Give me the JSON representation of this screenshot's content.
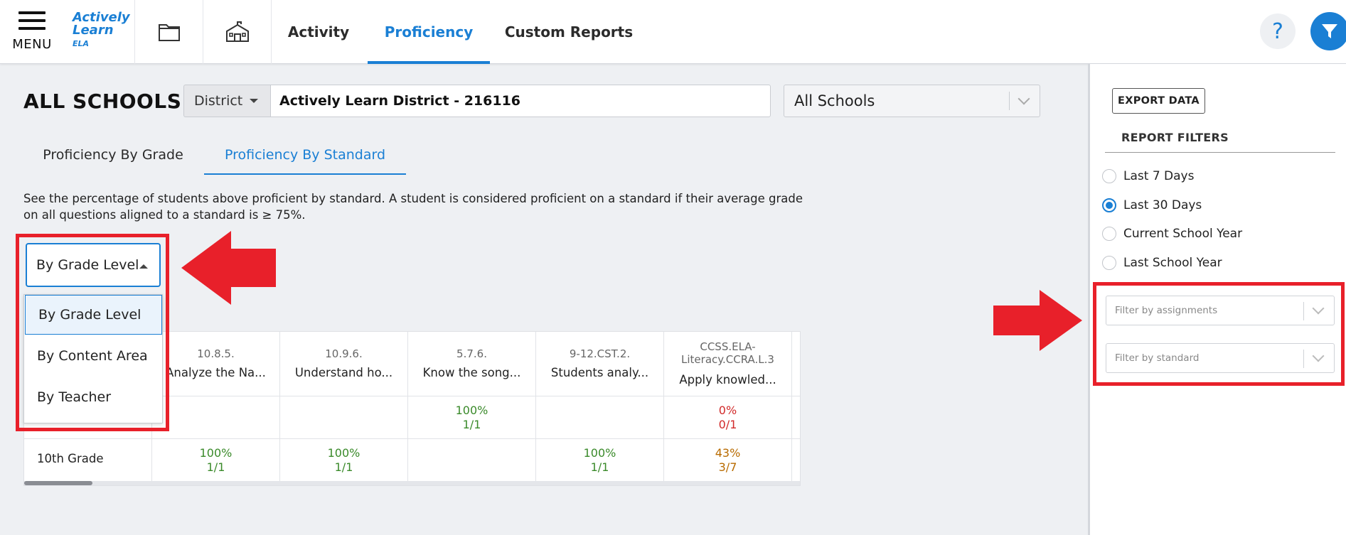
{
  "nav": {
    "menu_label": "MENU",
    "logo_line1": "Actively",
    "logo_line2": "Learn",
    "logo_sub": "ELA",
    "tabs": [
      {
        "label": "Activity"
      },
      {
        "label": "Proficiency"
      },
      {
        "label": "Custom Reports"
      }
    ],
    "active_tab": "Proficiency",
    "help_label": "?"
  },
  "header": {
    "title": "ALL SCHOOLS",
    "scope_select": "District",
    "district_value": "Actively Learn District - 216116",
    "schools_select": "All Schools"
  },
  "sub_tabs": [
    {
      "label": "Proficiency By Grade"
    },
    {
      "label": "Proficiency By Standard"
    }
  ],
  "active_sub_tab": "Proficiency By Standard",
  "description": "See the percentage of students above proficient by standard. A student is considered proficient on a standard if their average grade on all questions aligned to a standard is ≥ 75%.",
  "grouping": {
    "selected": "By Grade Level",
    "options": [
      "By Grade Level",
      "By Content Area",
      "By Teacher"
    ]
  },
  "table": {
    "columns": [
      {
        "code": "10.8.5.",
        "name": "Analyze the Na..."
      },
      {
        "code": "10.9.6.",
        "name": "Understand ho..."
      },
      {
        "code": "5.7.6.",
        "name": "Know the song..."
      },
      {
        "code": "9-12.CST.2.",
        "name": "Students analy..."
      },
      {
        "code": "CCSS.ELA-Literacy.CCRA.L.3",
        "name": "Apply knowled..."
      }
    ],
    "rows": [
      {
        "label": "",
        "cells": [
          {
            "pct": "",
            "frac": ""
          },
          {
            "pct": "",
            "frac": ""
          },
          {
            "pct": "100%",
            "frac": "1/1",
            "color": "#3a8a2a"
          },
          {
            "pct": "",
            "frac": ""
          },
          {
            "pct": "0%",
            "frac": "0/1",
            "color": "#d12a2a"
          }
        ]
      },
      {
        "label": "10th Grade",
        "cells": [
          {
            "pct": "100%",
            "frac": "1/1",
            "color": "#3a8a2a"
          },
          {
            "pct": "100%",
            "frac": "1/1",
            "color": "#3a8a2a"
          },
          {
            "pct": "",
            "frac": ""
          },
          {
            "pct": "100%",
            "frac": "1/1",
            "color": "#3a8a2a"
          },
          {
            "pct": "43%",
            "frac": "3/7",
            "color": "#b86b00"
          }
        ]
      }
    ]
  },
  "right_panel": {
    "export_label": "EXPORT DATA",
    "filters_title": "REPORT FILTERS",
    "date_options": [
      "Last 7 Days",
      "Last 30 Days",
      "Current School Year",
      "Last School Year"
    ],
    "date_selected": "Last 30 Days",
    "assignments_placeholder": "Filter by assignments",
    "standard_placeholder": "Filter by standard"
  },
  "colors": {
    "accent": "#1a7fd4",
    "annotation": "#e8202a"
  }
}
